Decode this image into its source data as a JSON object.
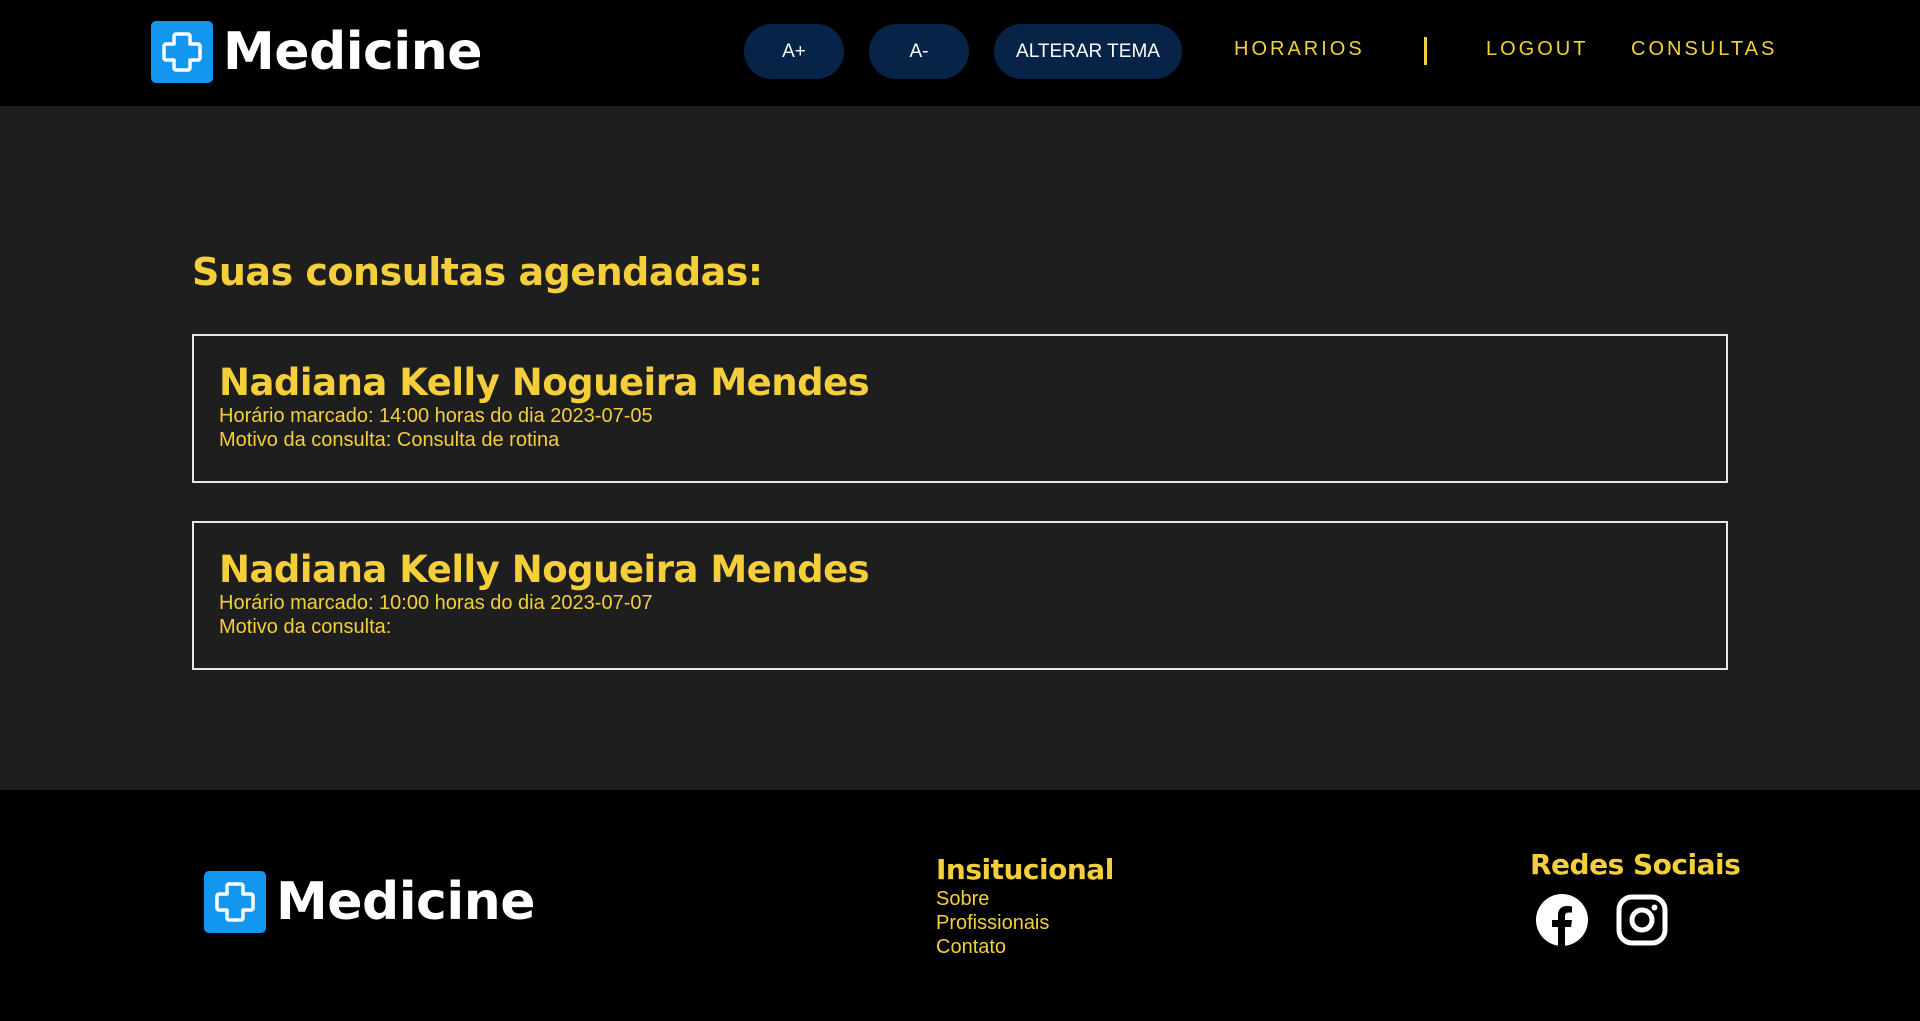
{
  "header": {
    "logo_text": "Medicine",
    "buttons": {
      "increase_font": "A+",
      "decrease_font": "A-",
      "toggle_theme": "ALTERAR TEMA"
    },
    "nav": {
      "horarios": "HORARIOS",
      "logout": "LOGOUT",
      "consultas": "CONSULTAS"
    }
  },
  "main": {
    "title": "Suas consultas agendadas:",
    "appointments": [
      {
        "patient": "Nadiana Kelly Nogueira Mendes",
        "schedule": "Horário marcado: 14:00 horas do dia 2023-07-05",
        "reason": "Motivo da consulta: Consulta de rotina"
      },
      {
        "patient": "Nadiana Kelly Nogueira Mendes",
        "schedule": "Horário marcado: 10:00 horas do dia 2023-07-07",
        "reason": "Motivo da consulta:"
      }
    ]
  },
  "footer": {
    "logo_text": "Medicine",
    "institutional": {
      "title": "Insitucional",
      "links": [
        "Sobre",
        "Profissionais",
        "Contato"
      ]
    },
    "social": {
      "title": "Redes Sociais",
      "icons": [
        "facebook-icon",
        "instagram-icon"
      ]
    }
  },
  "colors": {
    "accent": "#f4cf3b",
    "brand_blue": "#1296f0",
    "pill_bg": "#072348",
    "header_bg": "#000000",
    "page_bg": "#1e1e1e"
  }
}
